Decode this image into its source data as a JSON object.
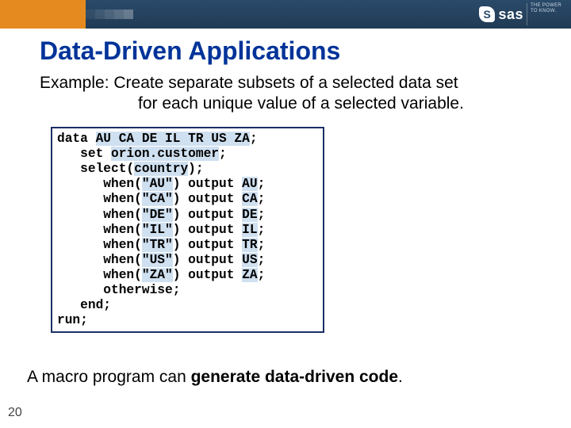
{
  "brand": {
    "logo_text": "sas",
    "logo_s": "S",
    "tagline": "THE\nPOWER\nTO KNOW."
  },
  "title": "Data-Driven Applications",
  "example": {
    "line1": "Example:  Create separate subsets of a selected data set",
    "line2": "for each unique value of a selected variable."
  },
  "code": {
    "l01a": "data ",
    "l01b": "AU CA DE IL TR US ZA",
    "l01c": ";",
    "l02a": "   set ",
    "l02b": "orion.customer",
    "l02c": ";",
    "l03a": "   select(",
    "l03b": "country",
    "l03c": ");",
    "l04a": "      when(",
    "l04b": "\"AU\"",
    "l04c": ") output ",
    "l04d": "AU",
    "l04e": ";",
    "l05a": "      when(",
    "l05b": "\"CA\"",
    "l05c": ") output ",
    "l05d": "CA",
    "l05e": ";",
    "l06a": "      when(",
    "l06b": "\"DE\"",
    "l06c": ") output ",
    "l06d": "DE",
    "l06e": ";",
    "l07a": "      when(",
    "l07b": "\"IL\"",
    "l07c": ") output ",
    "l07d": "IL",
    "l07e": ";",
    "l08a": "      when(",
    "l08b": "\"TR\"",
    "l08c": ") output ",
    "l08d": "TR",
    "l08e": ";",
    "l09a": "      when(",
    "l09b": "\"US\"",
    "l09c": ") output ",
    "l09d": "US",
    "l09e": ";",
    "l10a": "      when(",
    "l10b": "\"ZA\"",
    "l10c": ") output ",
    "l10d": "ZA",
    "l10e": ";",
    "l11": "      otherwise;",
    "l12": "   end;",
    "l13": "run;"
  },
  "footer": {
    "pre": "A macro program can ",
    "bold": "generate data-driven code",
    "post": "."
  },
  "page_number": "20"
}
